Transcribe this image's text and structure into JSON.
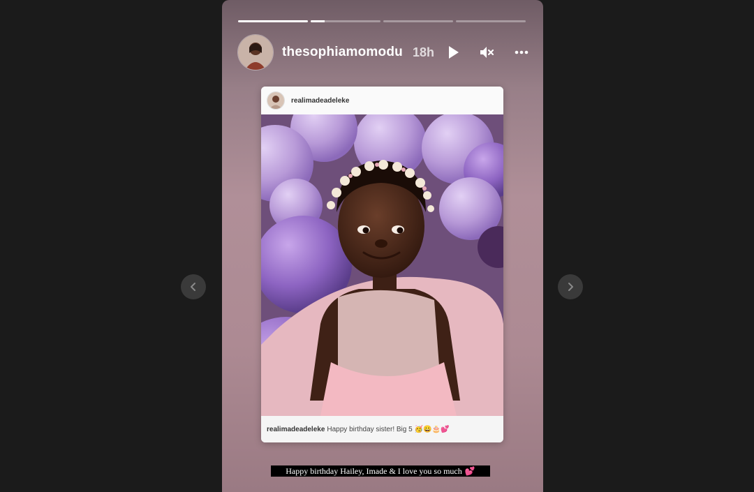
{
  "story": {
    "username": "thesophiamomodu",
    "time": "18h",
    "progress_segments": [
      1,
      0.2,
      0,
      0
    ]
  },
  "card": {
    "username": "realimadeadeleke",
    "caption_user": "realimadeadeleke",
    "caption_text": "Happy birthday sister! Big 5",
    "caption_emojis": "🥳😀🎂💕"
  },
  "caption": {
    "text": "Happy birthday Hailey, Imade & I love you so much",
    "heart": "💕"
  },
  "colors": {
    "background": "#1b1b1b",
    "story_bg": "#b08f98",
    "card_bg": "#f3f3f3"
  },
  "icons": [
    "chevron-left-icon",
    "chevron-right-icon",
    "play-icon",
    "mute-icon",
    "more-icon"
  ]
}
